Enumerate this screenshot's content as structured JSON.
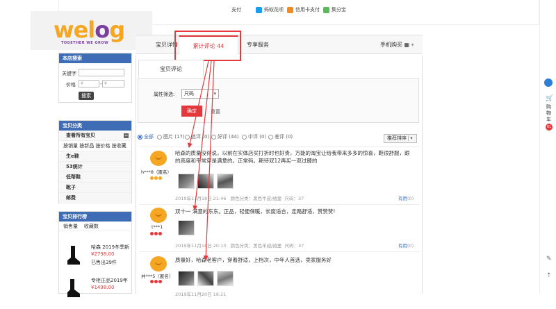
{
  "payment": {
    "items": [
      {
        "label": "支付",
        "icon": "",
        "color": ""
      },
      {
        "label": "蚂蚁花呗",
        "icon": "huabei-icon",
        "color": "#1a9cf0"
      },
      {
        "label": "信用卡支付",
        "icon": "credit-card-icon",
        "color": "#f08a24"
      },
      {
        "label": "集分宝",
        "icon": "jifenbao-icon",
        "color": "#5cb85c"
      }
    ]
  },
  "logo": {
    "word_a": "wel",
    "word_b": "o",
    "word_c": "g",
    "tagline": "TOGETHER WE GROW"
  },
  "tabs": {
    "detail": "宝贝详情",
    "reviews": "累计评论 44",
    "service": "专享服务",
    "mobile": "手机购买"
  },
  "search": {
    "header": "本店搜索",
    "keyword_label": "关键字",
    "price_label": "价格",
    "currency": "¥",
    "button": "搜索"
  },
  "categories": {
    "header": "宝贝分类",
    "view_all": "查看所有宝贝",
    "sort_links": "按销量 按新品 按价格 按收藏",
    "items": [
      "生e鞋",
      "53统计",
      "低帮鞋",
      "靴子",
      "邮费"
    ]
  },
  "ranking": {
    "header": "宝贝排行榜",
    "tab_sales": "销售量",
    "tab_fav": "收藏数",
    "items": [
      {
        "name": "哈森 2019冬季新",
        "price": "¥2798.00",
        "sold": "已售出39件"
      },
      {
        "name": "专柜正品2019年",
        "price": "¥1498.00",
        "sold": ""
      }
    ]
  },
  "review_panel": {
    "subtab": "宝贝评论",
    "attr_label": "属性筛选:",
    "attr_value": "尺码",
    "confirm": "确定",
    "reset": "重置"
  },
  "filters": [
    {
      "label": "全部",
      "on": true
    },
    {
      "label": "图片 (17)",
      "on": false
    },
    {
      "label": "追评 (0)",
      "on": false
    },
    {
      "label": "好评 (44)",
      "on": false
    },
    {
      "label": "中评 (0)",
      "on": false
    },
    {
      "label": "差评 (0)",
      "on": false
    }
  ],
  "sort_label": "推荐排序",
  "reviews": [
    {
      "user": "h***8（匿名）",
      "text1": "哈森的质量没得说，以前在实体店买打折时也好贵，万能的淘宝让给我带来多多的惊喜，鞋很舒服，跟",
      "text2": "的高度和平常穿是满意的。正常码。期待双12再买一双过膝的",
      "date": "2019年11月18日 21:46",
      "color": "颜色分类：黑色牛皮/绒里",
      "size": "尺码：37",
      "useful": "有用",
      "count": "(0)"
    },
    {
      "user": "t***1",
      "text1": "双十一 满意的东东。正品，轻便保暖，长度适合，走路舒适，赞赞赞!",
      "text2": "",
      "date": "2019年11月18日 20:13",
      "color": "颜色分类：黑色羊绒/绒里",
      "size": "尺码：37",
      "useful": "有用",
      "count": "(0)"
    },
    {
      "user": "井***5（匿名）",
      "text1": "质量好，哈森老客户，穿着舒适，上档次，中年人首选，卖家服务好",
      "text2": "",
      "date": "2019年11月20日 18:21",
      "color": "颜色分类：黑色牛皮/绒里",
      "size": "尺码：37",
      "useful": "有用",
      "count": "(0)"
    }
  ],
  "cart": {
    "label": "购物车",
    "count": "61"
  }
}
